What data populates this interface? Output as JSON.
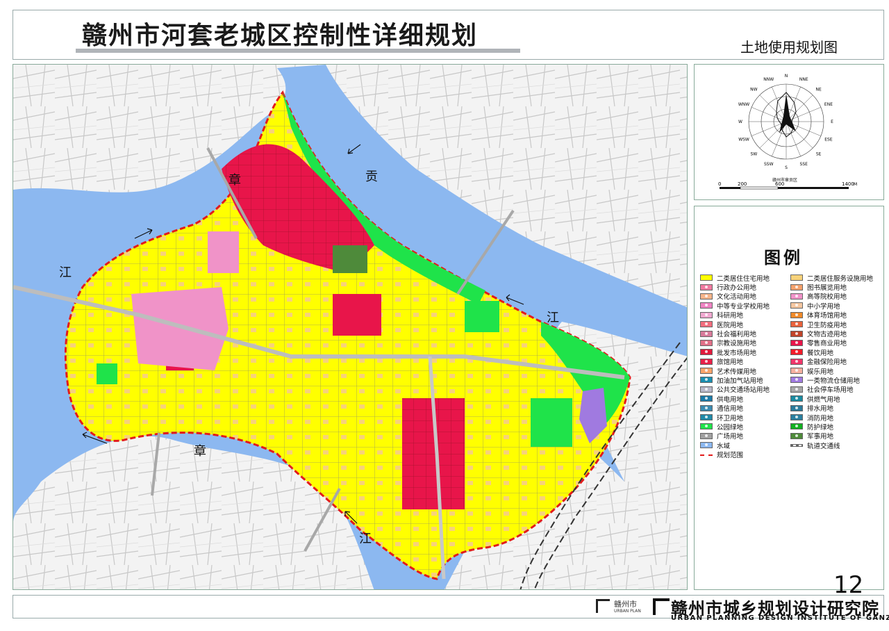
{
  "header": {
    "title": "赣州市河套老城区控制性详细规划",
    "subtitle": "土地使用规划图"
  },
  "map": {
    "labels": {
      "zhang_north": "章",
      "gong": "贡",
      "jiang_west": "江",
      "jiang_east": "江",
      "zhang_south": "章",
      "jiang_south": "江"
    }
  },
  "compass": {
    "directions": [
      "N",
      "NNE",
      "NE",
      "ENE",
      "E",
      "ESE",
      "SE",
      "SSE",
      "S",
      "SSW",
      "SW",
      "WSW",
      "W",
      "WNW",
      "NW",
      "NNW"
    ],
    "caption": "赣州市章贡区",
    "scale_labels": [
      "0",
      "200",
      "600",
      "1400"
    ],
    "scale_unit": "M"
  },
  "legend": {
    "title": "图例",
    "items": [
      {
        "label": "二类居住住宅用地",
        "color": "#ffff00"
      },
      {
        "label": "二类居住服务设施用地",
        "color": "#f7d27a"
      },
      {
        "label": "行政办公用地",
        "color": "#f07aa0"
      },
      {
        "label": "图书展览用地",
        "color": "#f4a16b"
      },
      {
        "label": "文化活动用地",
        "color": "#f6b58a"
      },
      {
        "label": "高等院校用地",
        "color": "#f093c8"
      },
      {
        "label": "中等专业学校用地",
        "color": "#ee82c2"
      },
      {
        "label": "中小学用地",
        "color": "#f4c6a0"
      },
      {
        "label": "科研用地",
        "color": "#f0a8d0"
      },
      {
        "label": "体育场馆用地",
        "color": "#f08a2a"
      },
      {
        "label": "医院用地",
        "color": "#f26d7d"
      },
      {
        "label": "卫生防疫用地",
        "color": "#e8623c"
      },
      {
        "label": "社会福利用地",
        "color": "#d77a9a"
      },
      {
        "label": "文物古迹用地",
        "color": "#c0452a"
      },
      {
        "label": "宗教设施用地",
        "color": "#e07088"
      },
      {
        "label": "零售商业用地",
        "color": "#e8154a"
      },
      {
        "label": "批发市场用地",
        "color": "#e01a3c"
      },
      {
        "label": "餐饮用地",
        "color": "#f21c2a"
      },
      {
        "label": "旅馆用地",
        "color": "#e82048"
      },
      {
        "label": "金融保险用地",
        "color": "#f0366a"
      },
      {
        "label": "艺术传媒用地",
        "color": "#f8a46a"
      },
      {
        "label": "娱乐用地",
        "color": "#f6b0a0"
      },
      {
        "label": "加油加气站用地",
        "color": "#1a8fb0"
      },
      {
        "label": "一类物流仓储用地",
        "color": "#a07ae0"
      },
      {
        "label": "公共交通场站用地",
        "color": "#b8b8c8"
      },
      {
        "label": "社会停车场用地",
        "color": "#a8a8a8"
      },
      {
        "label": "供电用地",
        "color": "#1a7aa8"
      },
      {
        "label": "供燃气用地",
        "color": "#1a8aa0"
      },
      {
        "label": "通信用地",
        "color": "#3a8ab0"
      },
      {
        "label": "排水用地",
        "color": "#2a7a9a"
      },
      {
        "label": "环卫用地",
        "color": "#208aa8"
      },
      {
        "label": "消防用地",
        "color": "#2a80a0"
      },
      {
        "label": "公园绿地",
        "color": "#1fe34a"
      },
      {
        "label": "防护绿地",
        "color": "#12b020"
      },
      {
        "label": "广场用地",
        "color": "#a0a0a0"
      },
      {
        "label": "军事用地",
        "color": "#4e8a3a"
      },
      {
        "label": "水域",
        "color": "#8cb8f0"
      },
      {
        "label": "轨道交通线",
        "color": "#666666"
      },
      {
        "label": "规划范围",
        "color": "#e21b1b"
      }
    ]
  },
  "page_number": "12",
  "footer": {
    "small_cn": "赣州市",
    "small_en": "URBAN PLAN",
    "org_cn": "赣州市城乡规划设计研究院",
    "org_en": "URBAN PLANNING DESIGN INSTITUTE OF GANZHOU"
  }
}
